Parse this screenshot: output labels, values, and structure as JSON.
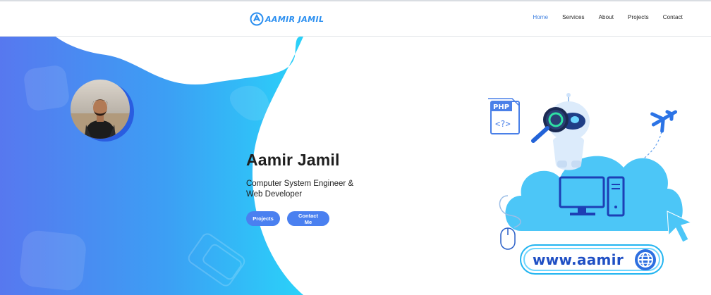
{
  "header": {
    "logo_text": "AAMIR JAMIL",
    "nav": [
      {
        "label": "Home",
        "active": true
      },
      {
        "label": "Services",
        "active": false
      },
      {
        "label": "About",
        "active": false
      },
      {
        "label": "Projects",
        "active": false
      },
      {
        "label": "Contact",
        "active": false
      }
    ]
  },
  "hero": {
    "name": "Aamir Jamil",
    "role": "Computer System Engineer & Web Developer",
    "buttons": {
      "projects_label": "Projects",
      "contact_label": "Contact Me"
    }
  },
  "illustration": {
    "php_label": "PHP",
    "php_code": "<?>",
    "url_text": "www.aamir"
  },
  "colors": {
    "accent": "#4a80f0",
    "gradient_start": "#5b7ff0",
    "gradient_end": "#2fd0f8",
    "cloud": "#4cc6f7",
    "nav_active": "#3d7fe0"
  },
  "icons": [
    "logo-icon",
    "robot-icon",
    "magnifier-icon",
    "php-file-icon",
    "airplane-icon",
    "computer-icon",
    "mouse-icon",
    "cursor-icon",
    "globe-icon"
  ]
}
